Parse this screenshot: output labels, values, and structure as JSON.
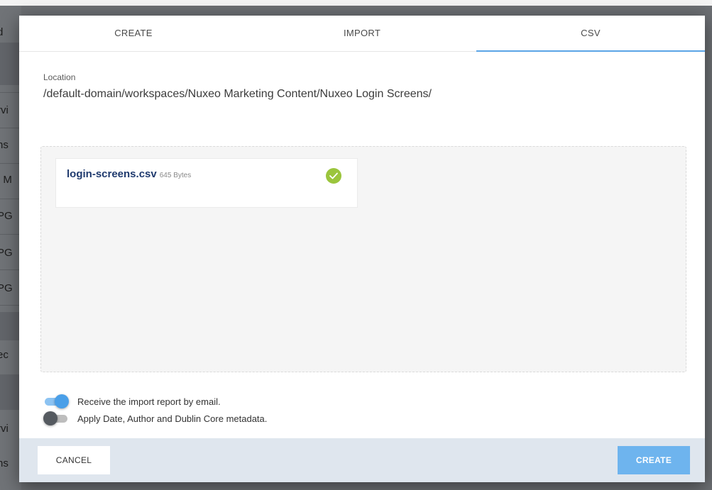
{
  "background": {
    "row_texts": [
      "d",
      "rvi",
      "ns",
      ": M",
      "PG",
      "PG",
      "PG",
      "ec",
      "rvi",
      "ns"
    ]
  },
  "tabs": [
    {
      "label": "CREATE",
      "active": false
    },
    {
      "label": "IMPORT",
      "active": false
    },
    {
      "label": "CSV",
      "active": true
    }
  ],
  "location": {
    "label": "Location",
    "path": "/default-domain/workspaces/Nuxeo Marketing Content/Nuxeo Login Screens/"
  },
  "file": {
    "name": "login-screens.csv",
    "size": "645 Bytes",
    "status_icon": "check-circle-icon",
    "status_color": "#9bc53d"
  },
  "options": [
    {
      "label": "Receive the import report by email.",
      "enabled": true
    },
    {
      "label": "Apply Date, Author and Dublin Core metadata.",
      "enabled": false
    }
  ],
  "footer": {
    "cancel_label": "CANCEL",
    "create_label": "CREATE"
  },
  "colors": {
    "accent": "#5aa5e6",
    "create_button": "#6eb4ee",
    "footer_bg": "#dfe6ee"
  }
}
